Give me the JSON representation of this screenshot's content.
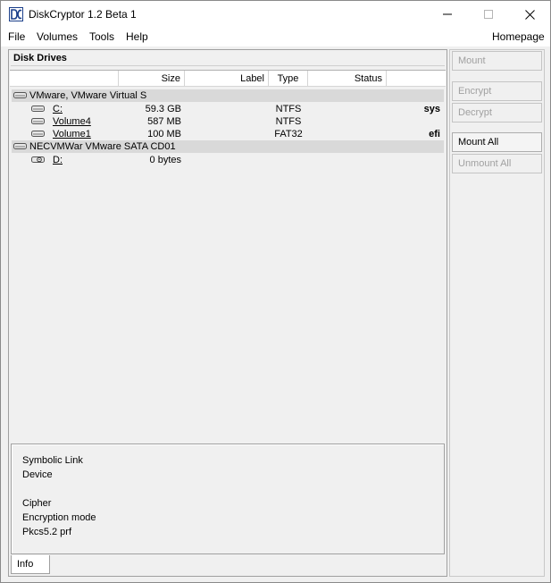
{
  "window": {
    "title": "DiskCryptor 1.2 Beta 1",
    "minimize_icon": "minimize-icon",
    "maximize_icon": "maximize-icon",
    "close_icon": "close-icon"
  },
  "menu": {
    "file": "File",
    "volumes": "Volumes",
    "tools": "Tools",
    "help": "Help",
    "homepage": "Homepage"
  },
  "drives_panel": {
    "title": "Disk Drives",
    "columns": [
      "",
      "Size",
      "Label",
      "Type",
      "Status",
      ""
    ],
    "groups": [
      {
        "name": "VMware, VMware Virtual S",
        "icon": "disk-icon",
        "volumes": [
          {
            "name": "C:",
            "size": "59.3 GB",
            "label": "",
            "type": "NTFS",
            "status": "",
            "flag": "sys",
            "icon": "hdd-icon"
          },
          {
            "name": "Volume4",
            "size": "587 MB",
            "label": "",
            "type": "NTFS",
            "status": "",
            "flag": "",
            "icon": "hdd-icon"
          },
          {
            "name": "Volume1",
            "size": "100 MB",
            "label": "",
            "type": "FAT32",
            "status": "",
            "flag": "efi",
            "icon": "hdd-icon"
          }
        ]
      },
      {
        "name": "NECVMWar VMware SATA CD01",
        "icon": "disk-icon",
        "volumes": [
          {
            "name": "D:",
            "size": "0 bytes",
            "label": "",
            "type": "",
            "status": "",
            "flag": "",
            "icon": "cdrom-icon"
          }
        ]
      }
    ]
  },
  "info_panel": {
    "symbolic_link": "Symbolic Link",
    "device": "Device",
    "cipher": "Cipher",
    "encryption_mode": "Encryption mode",
    "pkcs": "Pkcs5.2 prf",
    "tab_label": "Info"
  },
  "actions": {
    "mount": "Mount",
    "encrypt": "Encrypt",
    "decrypt": "Decrypt",
    "mount_all": "Mount All",
    "unmount_all": "Unmount All"
  }
}
